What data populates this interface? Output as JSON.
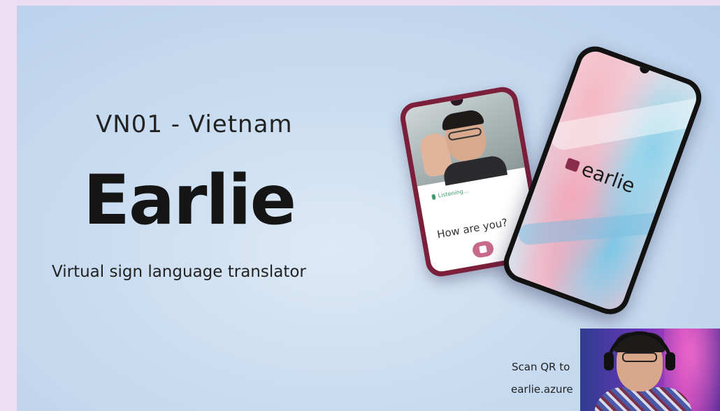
{
  "slide": {
    "subtitle": "VN01 - Vietnam",
    "title": "Earlie",
    "tagline": "Virtual sign language translator",
    "scan_text": "Scan QR to",
    "url_text": "earlie.azure"
  },
  "back_phone": {
    "status_text": "Listening...",
    "phrase": "How are you?"
  },
  "front_phone": {
    "logo_text": "earlie"
  },
  "colors": {
    "slide_background": "#c9dcf0",
    "back_phone_frame": "#7b1f3b",
    "logo_mark": "#8a2c4c",
    "listening_green": "#3f9a6a"
  }
}
